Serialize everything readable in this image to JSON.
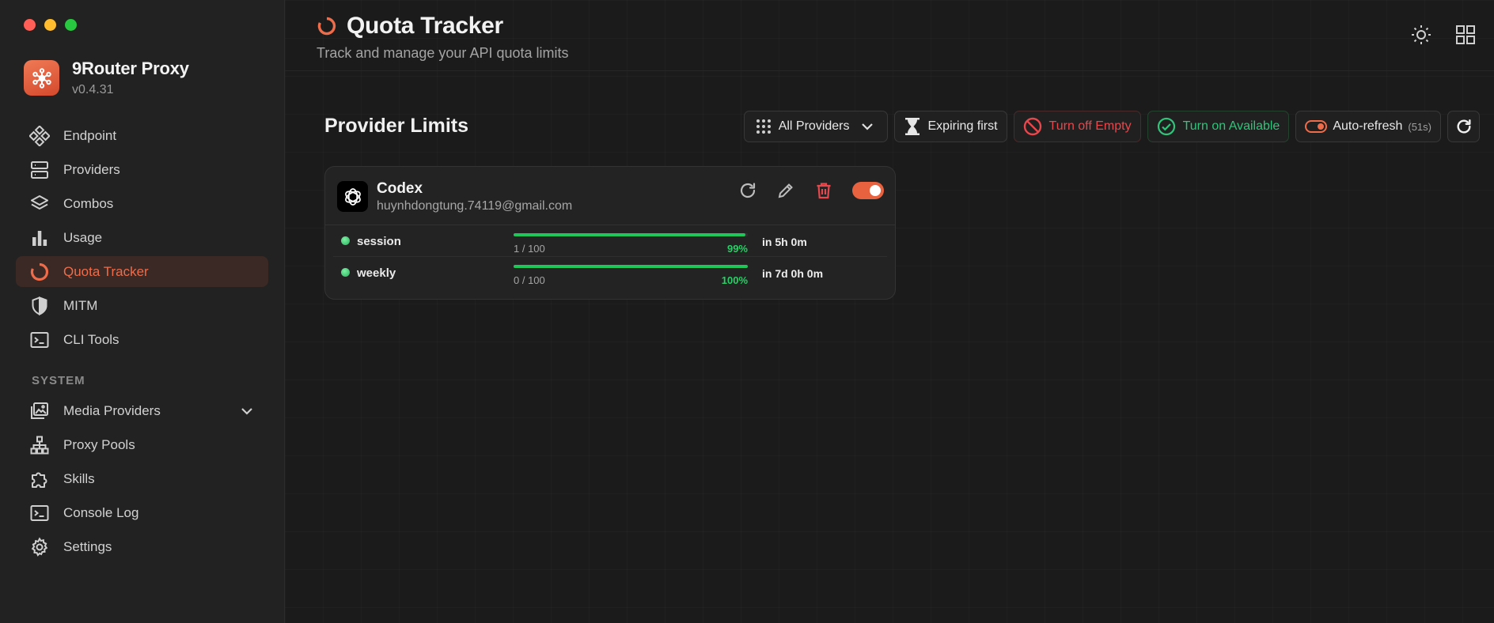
{
  "window": {
    "colors": {
      "close": "#ff5f57",
      "minimize": "#febc2e",
      "maximize": "#28c840"
    }
  },
  "brand": {
    "name": "9Router Proxy",
    "version": "v0.4.31",
    "accent": "#e8623f"
  },
  "sidebar": {
    "items": [
      {
        "label": "Endpoint",
        "icon": "endpoint-icon"
      },
      {
        "label": "Providers",
        "icon": "server-icon"
      },
      {
        "label": "Combos",
        "icon": "layers-icon"
      },
      {
        "label": "Usage",
        "icon": "bar-chart-icon"
      },
      {
        "label": "Quota Tracker",
        "icon": "quota-ring-icon",
        "active": true
      },
      {
        "label": "MITM",
        "icon": "shield-icon"
      },
      {
        "label": "CLI Tools",
        "icon": "terminal-icon"
      }
    ],
    "section_label": "SYSTEM",
    "system_items": [
      {
        "label": "Media Providers",
        "icon": "media-icon",
        "expandable": true
      },
      {
        "label": "Proxy Pools",
        "icon": "network-icon"
      },
      {
        "label": "Skills",
        "icon": "puzzle-icon"
      },
      {
        "label": "Console Log",
        "icon": "console-icon"
      },
      {
        "label": "Settings",
        "icon": "gear-icon"
      }
    ]
  },
  "header": {
    "title": "Quota Tracker",
    "subtitle": "Track and manage your API quota limits",
    "icons": [
      "theme-sun-icon",
      "grid-view-icon"
    ]
  },
  "main": {
    "section_title": "Provider Limits",
    "toolbar": {
      "providers_filter": "All Providers",
      "sort": "Expiring first",
      "turn_off_empty": "Turn off Empty",
      "turn_on_available": "Turn on Available",
      "auto_refresh": "Auto-refresh",
      "auto_refresh_countdown": "(51s)"
    },
    "cards": [
      {
        "provider": "Codex",
        "email": "huynhdongtung.74119@gmail.com",
        "enabled": true,
        "quotas": [
          {
            "name": "session",
            "count": "1 / 100",
            "percent_label": "99%",
            "remaining_fraction": 0.99,
            "reset": "in 5h 0m"
          },
          {
            "name": "weekly",
            "count": "0 / 100",
            "percent_label": "100%",
            "remaining_fraction": 1.0,
            "reset": "in 7d 0h 0m"
          }
        ]
      }
    ]
  },
  "colors": {
    "danger": "#e5484d",
    "success": "#30c47b",
    "bar": "#1fc65a"
  }
}
